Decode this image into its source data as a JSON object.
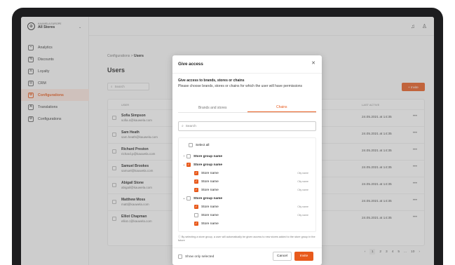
{
  "store": {
    "org": "KAUWELA EUROPE",
    "name": "All Stores"
  },
  "sidebar": {
    "items": [
      {
        "label": "Analytics",
        "icon": "analytics-icon",
        "glyph": "⌁"
      },
      {
        "label": "Discounts",
        "icon": "discount-icon",
        "glyph": "%"
      },
      {
        "label": "Loyalty",
        "icon": "loyalty-icon",
        "glyph": "♙"
      },
      {
        "label": "CRM",
        "icon": "crm-icon",
        "glyph": "◎"
      },
      {
        "label": "Configurations",
        "icon": "config-icon",
        "glyph": "⚙"
      },
      {
        "label": "Translations",
        "icon": "translate-icon",
        "glyph": "A"
      },
      {
        "label": "Configurations",
        "icon": "settings-icon",
        "glyph": "⚙"
      }
    ]
  },
  "breadcrumb": {
    "parent": "Configurations",
    "sep": ">",
    "current": "Users"
  },
  "page": {
    "title": "Users",
    "search_placeholder": "Search",
    "invite_label": "+ Invite"
  },
  "table": {
    "col_user": "USER",
    "col_last": "LAST ACTIVE",
    "rows": [
      {
        "name": "Sofia Simpson",
        "email": "sofia.s@kauwela.com",
        "last": "24.05.2021 at 14:35"
      },
      {
        "name": "Sam Heath",
        "email": "sam.heath@kauwela.com",
        "last": "24.05.2021 at 14:35"
      },
      {
        "name": "Richard Preston",
        "email": "richard.p@kauwela.com",
        "last": "24.05.2021 at 14:35"
      },
      {
        "name": "Samuel Brookes",
        "email": "samuel@kauwela.com",
        "last": "24.05.2021 at 14:35"
      },
      {
        "name": "Abigail Stone",
        "email": "abigail@kauwela.com",
        "last": "24.05.2021 at 14:35"
      },
      {
        "name": "Matthew Moss",
        "email": "matt@kauwela.com",
        "last": "24.05.2021 at 14:35"
      },
      {
        "name": "Elliot Chapman",
        "email": "elliot.c@kauwela.com",
        "last": "24.05.2021 at 14:35"
      }
    ]
  },
  "pagination": {
    "pages": [
      "1",
      "2",
      "3",
      "4",
      "5",
      "...",
      "10"
    ],
    "current": "1"
  },
  "modal": {
    "title": "Give access",
    "subtitle": "Give access to brands, stores or chains",
    "description": "Please choose brands, stores or chains for which the user will have permissions",
    "tabs": [
      "Brands and stores",
      "Chains"
    ],
    "active_tab": "Chains",
    "search_placeholder": "Search",
    "select_all": "Select all",
    "tree": [
      {
        "level": 0,
        "arrow": ">",
        "check": "none",
        "label": "Store group name",
        "bold": true
      },
      {
        "level": 0,
        "arrow": "v",
        "check": "on",
        "label": "Store group name",
        "bold": true
      },
      {
        "level": 1,
        "arrow": "",
        "check": "on",
        "label": "Store name",
        "city": "City name"
      },
      {
        "level": 1,
        "arrow": "",
        "check": "on",
        "label": "Store name",
        "city": "City name"
      },
      {
        "level": 1,
        "arrow": "",
        "check": "on",
        "label": "Store name",
        "city": "City name"
      },
      {
        "level": 0,
        "arrow": "v",
        "check": "none",
        "label": "Store group name",
        "bold": true
      },
      {
        "level": 1,
        "arrow": "",
        "check": "on",
        "label": "Store name",
        "city": "City name"
      },
      {
        "level": 1,
        "arrow": "",
        "check": "none",
        "label": "Store name",
        "city": "City name"
      },
      {
        "level": 1,
        "arrow": "",
        "check": "on",
        "label": "Store name",
        "city": ""
      }
    ],
    "note": "By selecting a store group, a user will automatically be given access to new stores added to the store group in the future",
    "show_only_selected": "Show only selected",
    "cancel": "Cancel",
    "invite": "Invite"
  },
  "colors": {
    "accent": "#e85a1c"
  }
}
